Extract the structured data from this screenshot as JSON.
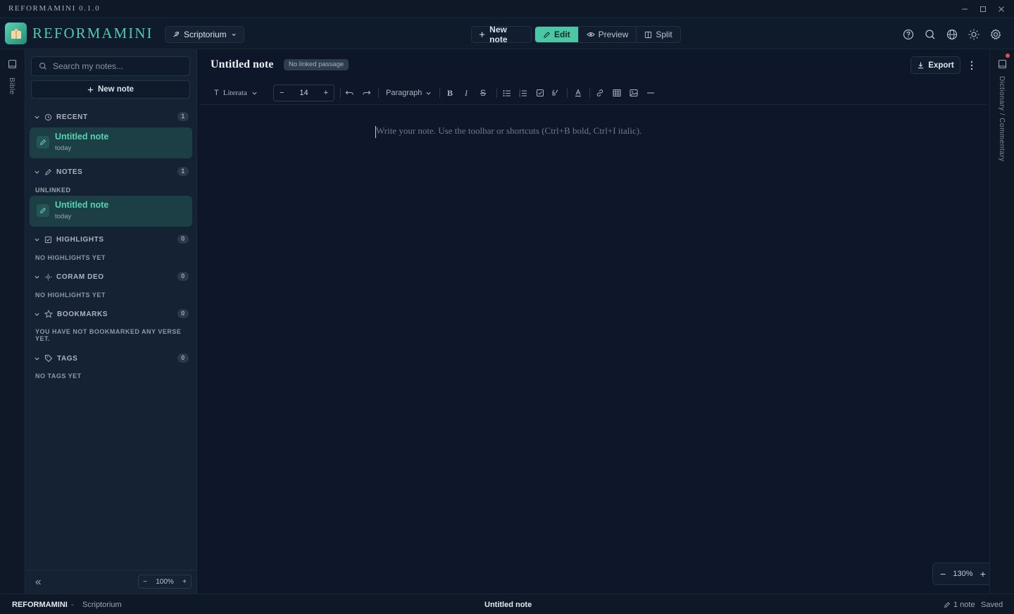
{
  "window": {
    "title": "REFORMAMINI 0.1.0"
  },
  "header": {
    "brand": "REFORMAMINI",
    "workspace": "Scriptorium",
    "new_note": "New note",
    "modes": [
      {
        "label": "Edit",
        "icon": "pencil-icon",
        "active": true
      },
      {
        "label": "Preview",
        "icon": "eye-icon",
        "active": false
      },
      {
        "label": "Split",
        "icon": "split-icon",
        "active": false
      }
    ],
    "accent": "#4cc7a6"
  },
  "left_rail": {
    "label": "Bible"
  },
  "sidebar": {
    "search_placeholder": "Search my notes...",
    "new_note": "New note",
    "recent": {
      "label": "RECENT",
      "count": "1",
      "note_title": "Untitled note",
      "note_date": "today"
    },
    "notes": {
      "label": "NOTES",
      "count": "1",
      "group": "UNLINKED",
      "note_title": "Untitled note",
      "note_date": "today"
    },
    "highlights": {
      "label": "HIGHLIGHTS",
      "count": "0",
      "empty": "NO HIGHLIGHTS YET"
    },
    "coram_deo": {
      "label": "CORAM DEO",
      "count": "0",
      "empty": "NO HIGHLIGHTS YET"
    },
    "bookmarks": {
      "label": "BOOKMARKS",
      "count": "0",
      "empty": "YOU HAVE NOT BOOKMARKED ANY VERSE YET."
    },
    "tags": {
      "label": "TAGS",
      "count": "0",
      "empty": "NO TAGS YET"
    },
    "zoom": "100%"
  },
  "editor": {
    "title": "Untitled note",
    "badge": "No linked passage",
    "export": "Export",
    "font": "Literata",
    "font_size": "14",
    "block_style": "Paragraph",
    "placeholder": "Write your note. Use the toolbar or shortcuts (Ctrl+B bold, Ctrl+I italic).",
    "zoom": "130%"
  },
  "right_rail": {
    "label": "Dictionary / Commentary"
  },
  "statusbar": {
    "app": "REFORMAMINI",
    "separator": "-",
    "workspace": "Scriptorium",
    "current_note": "Untitled note",
    "note_count": "1 note",
    "save_state": "Saved"
  }
}
